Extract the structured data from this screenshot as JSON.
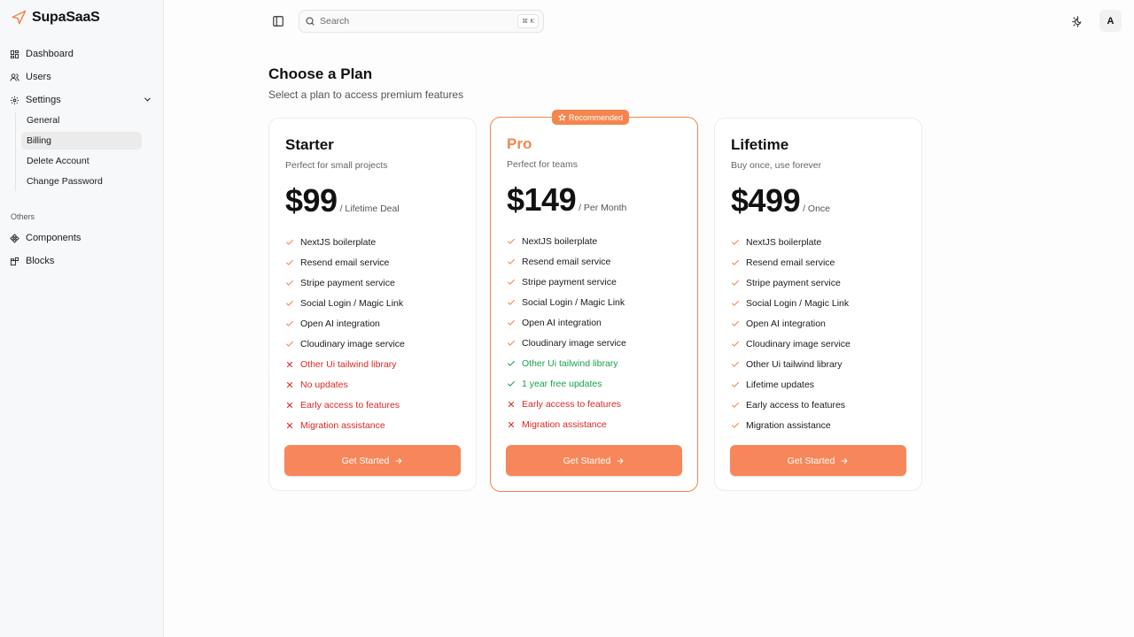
{
  "app": {
    "brand": "SupaSaaS"
  },
  "sidebar": {
    "items": [
      {
        "label": "Dashboard",
        "icon": "dashboard-icon"
      },
      {
        "label": "Users",
        "icon": "users-icon"
      },
      {
        "label": "Settings",
        "icon": "gear-icon"
      }
    ],
    "settings_sub": [
      {
        "label": "General"
      },
      {
        "label": "Billing",
        "active": true
      },
      {
        "label": "Delete Account"
      },
      {
        "label": "Change Password"
      }
    ],
    "others_label": "Others",
    "others": [
      {
        "label": "Components",
        "icon": "components-icon"
      },
      {
        "label": "Blocks",
        "icon": "blocks-icon"
      }
    ]
  },
  "header": {
    "search_placeholder": "Search",
    "search_shortcut": "⌘ K",
    "avatar_initial": "A"
  },
  "main": {
    "title": "Choose a Plan",
    "subtitle": "Select a plan to access premium features"
  },
  "colors": {
    "accent": "#f4854e",
    "button": "#f7865a",
    "negative": "#dc2626",
    "positive": "#16a34a"
  },
  "plans": [
    {
      "name": "Starter",
      "desc": "Perfect for small projects",
      "price": "$99",
      "period": "/ Lifetime Deal",
      "cta": "Get Started",
      "features": [
        {
          "text": "NextJS boilerplate",
          "status": "included"
        },
        {
          "text": "Resend email service",
          "status": "included"
        },
        {
          "text": "Stripe payment service",
          "status": "included"
        },
        {
          "text": "Social Login / Magic Link",
          "status": "included"
        },
        {
          "text": "Open AI integration",
          "status": "included"
        },
        {
          "text": "Cloudinary image service",
          "status": "included"
        },
        {
          "text": "Other Ui tailwind library",
          "status": "excluded"
        },
        {
          "text": "No updates",
          "status": "excluded"
        },
        {
          "text": "Early access to features",
          "status": "excluded"
        },
        {
          "text": "Migration assistance",
          "status": "excluded"
        }
      ]
    },
    {
      "name": "Pro",
      "desc": "Perfect for teams",
      "price": "$149",
      "period": "/ Per Month",
      "cta": "Get Started",
      "badge": "Recommended",
      "features": [
        {
          "text": "NextJS boilerplate",
          "status": "included"
        },
        {
          "text": "Resend email service",
          "status": "included"
        },
        {
          "text": "Stripe payment service",
          "status": "included"
        },
        {
          "text": "Social Login / Magic Link",
          "status": "included"
        },
        {
          "text": "Open AI integration",
          "status": "included"
        },
        {
          "text": "Cloudinary image service",
          "status": "included"
        },
        {
          "text": "Other Ui tailwind library",
          "status": "highlight"
        },
        {
          "text": "1 year free updates",
          "status": "highlight"
        },
        {
          "text": "Early access to features",
          "status": "excluded"
        },
        {
          "text": "Migration assistance",
          "status": "excluded"
        }
      ]
    },
    {
      "name": "Lifetime",
      "desc": "Buy once, use forever",
      "price": "$499",
      "period": "/ Once",
      "cta": "Get Started",
      "features": [
        {
          "text": "NextJS boilerplate",
          "status": "included"
        },
        {
          "text": "Resend email service",
          "status": "included"
        },
        {
          "text": "Stripe payment service",
          "status": "included"
        },
        {
          "text": "Social Login / Magic Link",
          "status": "included"
        },
        {
          "text": "Open AI integration",
          "status": "included"
        },
        {
          "text": "Cloudinary image service",
          "status": "included"
        },
        {
          "text": "Other Ui tailwind library",
          "status": "included"
        },
        {
          "text": "Lifetime updates",
          "status": "included"
        },
        {
          "text": "Early access to features",
          "status": "included"
        },
        {
          "text": "Migration assistance",
          "status": "included"
        }
      ]
    }
  ]
}
